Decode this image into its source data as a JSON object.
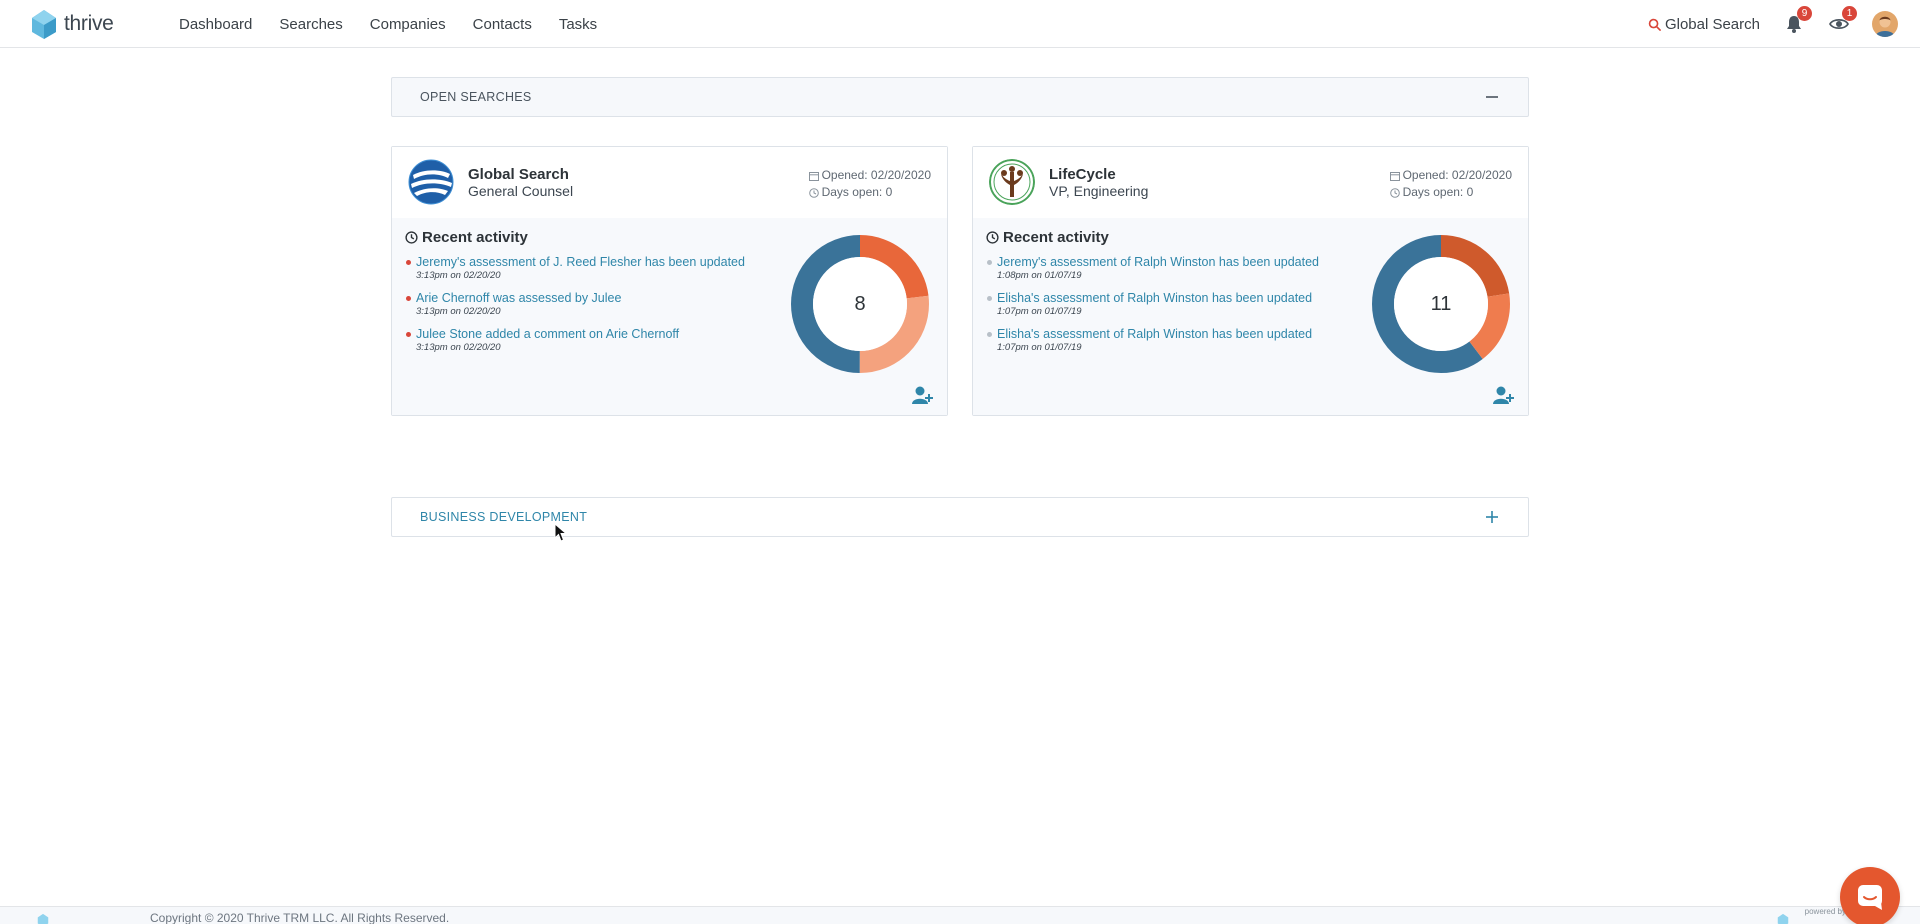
{
  "brand": {
    "name": "thrive",
    "logo_icon": "thrive-logo-icon",
    "accent": "#2f86a9"
  },
  "nav": {
    "items": [
      {
        "label": "Dashboard"
      },
      {
        "label": "Searches"
      },
      {
        "label": "Companies"
      },
      {
        "label": "Contacts"
      },
      {
        "label": "Tasks"
      }
    ],
    "global_search_label": "Global Search",
    "notifications_count": "9",
    "watch_count": "1"
  },
  "open_searches": {
    "title": "OPEN SEARCHES",
    "toggle_icon": "minus-icon",
    "cards": [
      {
        "company": "Global Search",
        "position": "General Counsel",
        "opened": "Opened: 02/20/2020",
        "days_open": "Days open: 0",
        "activity_title": "Recent activity",
        "activity": [
          {
            "text": "Jeremy's assessment of J. Reed Flesher has been updated",
            "time": "3:13pm on 02/20/20"
          },
          {
            "text": "Arie Chernoff was assessed by Julee",
            "time": "3:13pm on 02/20/20"
          },
          {
            "text": "Julee Stone added a comment on Arie Chernoff",
            "time": "3:13pm on 02/20/20"
          }
        ],
        "candidate_count": "8"
      },
      {
        "company": "LifeCycle",
        "position": "VP, Engineering",
        "opened": "Opened: 02/20/2020",
        "days_open": "Days open: 0",
        "activity_title": "Recent activity",
        "activity": [
          {
            "text": "Jeremy's assessment of Ralph Winston has been updated",
            "time": "1:08pm on 01/07/19"
          },
          {
            "text": "Elisha's assessment of Ralph Winston has been updated",
            "time": "1:07pm on 01/07/19"
          },
          {
            "text": "Elisha's assessment of Ralph Winston has been updated",
            "time": "1:07pm on 01/07/19"
          }
        ],
        "candidate_count": "11"
      }
    ]
  },
  "business_development": {
    "title": "BUSINESS DEVELOPMENT",
    "toggle_icon": "plus-icon"
  },
  "footer": {
    "copyright": "Copyright © 2020 Thrive TRM LLC. All Rights Reserved.",
    "powered_by": "powered by"
  },
  "colors": {
    "donut_blue": "#3a7399",
    "donut_orange": "#e8673a",
    "donut_light_orange": "#f4a27e",
    "donut_dark_orange": "#cf5a2c",
    "dot_red": "#d9463a",
    "dot_gray": "#b8c0c8",
    "chat": "#e4572e"
  }
}
